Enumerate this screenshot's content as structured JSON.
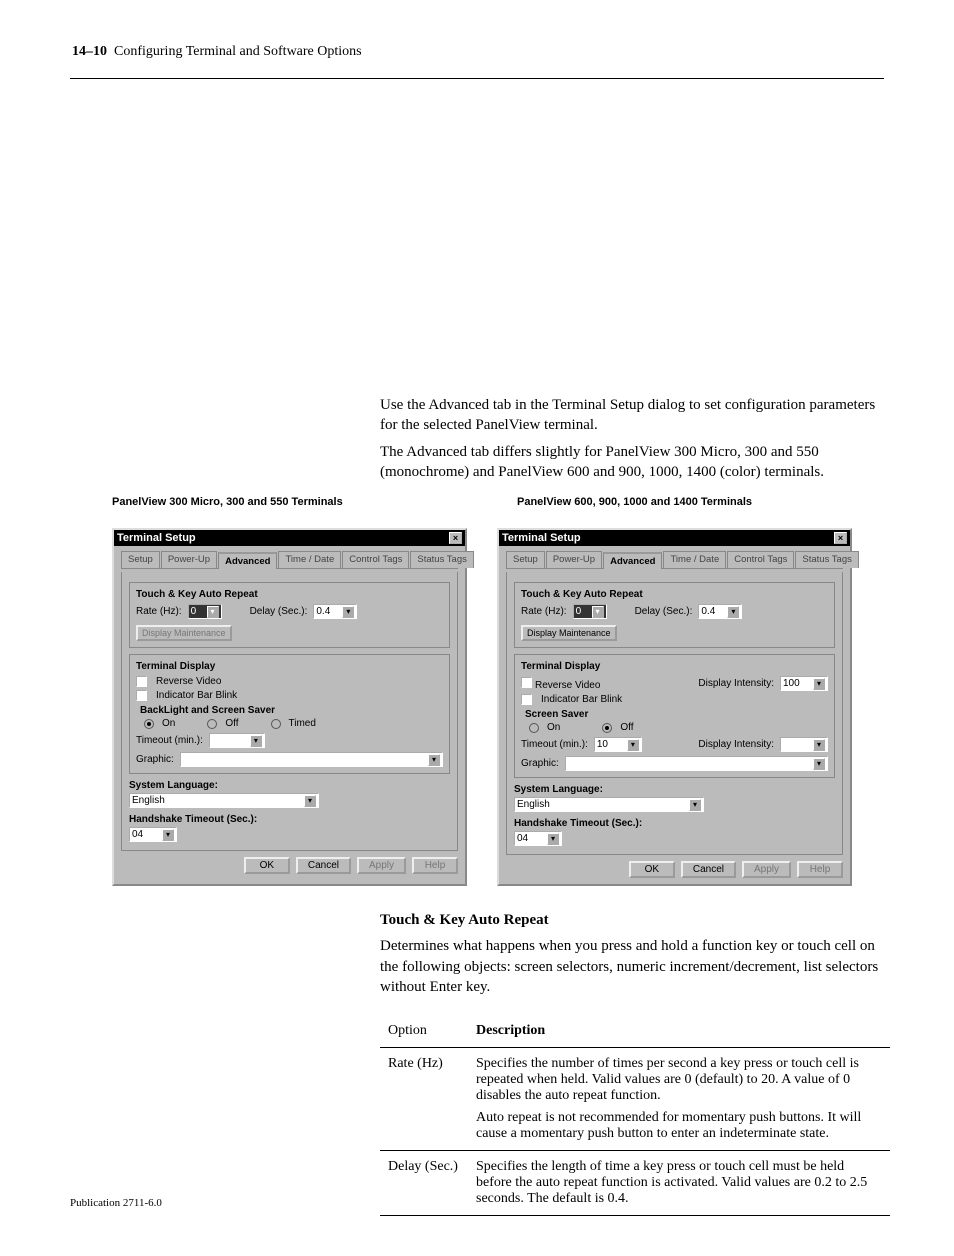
{
  "header": {
    "left_chapter": "14–10",
    "left_title": "Configuring Terminal and Software Options",
    "right_pub": "Publication 2711-6.0"
  },
  "intro": {
    "p1": "Use the Advanced tab in the Terminal Setup dialog to set configuration parameters for the selected PanelView terminal.",
    "p2": "The Advanced tab differs slightly for PanelView 300 Micro, 300 and 550 (monochrome) and PanelView 600 and 900, 1000, 1400 (color) terminals.",
    "caption_left": "PanelView 300 Micro, 300 and 550 Terminals",
    "caption_right": "PanelView 600, 900, 1000 and 1400 Terminals"
  },
  "sect_heads": {
    "touch_key": "Touch & Key Auto Repeat"
  },
  "touch_key_paragraph": "Determines what happens when you press and hold a function key or touch cell on the following objects: screen selectors, numeric increment/decrement, list selectors without Enter key.",
  "table": {
    "head_opt": "Option",
    "head_desc": "Description",
    "rows": [
      {
        "opt": "Rate (Hz)",
        "desc": "Specifies the number of times per second a key press or touch cell is repeated when held. Valid values are 0 (default) to 20. A value of 0 disables the auto repeat function.",
        "note": "Auto repeat is not recommended for momentary push buttons. It will cause a momentary push button to enter an indeterminate state."
      },
      {
        "opt": "Delay (Sec.)",
        "desc": "Specifies the length of time a key press or touch cell must be held before the auto repeat function is activated. Valid values are 0.2 to 2.5 seconds. The default is 0.4.",
        "note": ""
      }
    ]
  },
  "dialog": {
    "title": "Terminal Setup",
    "tabs": [
      "Setup",
      "Power-Up",
      "Advanced",
      "Time / Date",
      "Control Tags",
      "Status Tags"
    ],
    "touchkey_legend": "Touch & Key Auto Repeat",
    "rate_label": "Rate (Hz):",
    "rate_value": "0",
    "delay_label": "Delay (Sec.):",
    "delay_value": "0.4",
    "display_maintenance_btn": "Display Maintenance",
    "terminal_display_legend": "Terminal Display",
    "reverse_video": "Reverse Video",
    "indicator_bar_blink": "Indicator Bar Blink",
    "backlight_legend": "BackLight and Screen Saver",
    "screen_saver_legend": "Screen Saver",
    "radio_on": "On",
    "radio_off": "Off",
    "radio_timed": "Timed",
    "timeout_label": "Timeout (min.):",
    "timeout_val_right": "10",
    "graphic_label": "Graphic:",
    "disp_intensity_label": "Display Intensity:",
    "disp_intensity_value": "100",
    "sys_lang_label": "System Language:",
    "sys_lang_value": "English",
    "handshake_label": "Handshake Timeout (Sec.):",
    "handshake_value": "04",
    "btn_ok": "OK",
    "btn_cancel": "Cancel",
    "btn_apply": "Apply",
    "btn_help": "Help"
  }
}
